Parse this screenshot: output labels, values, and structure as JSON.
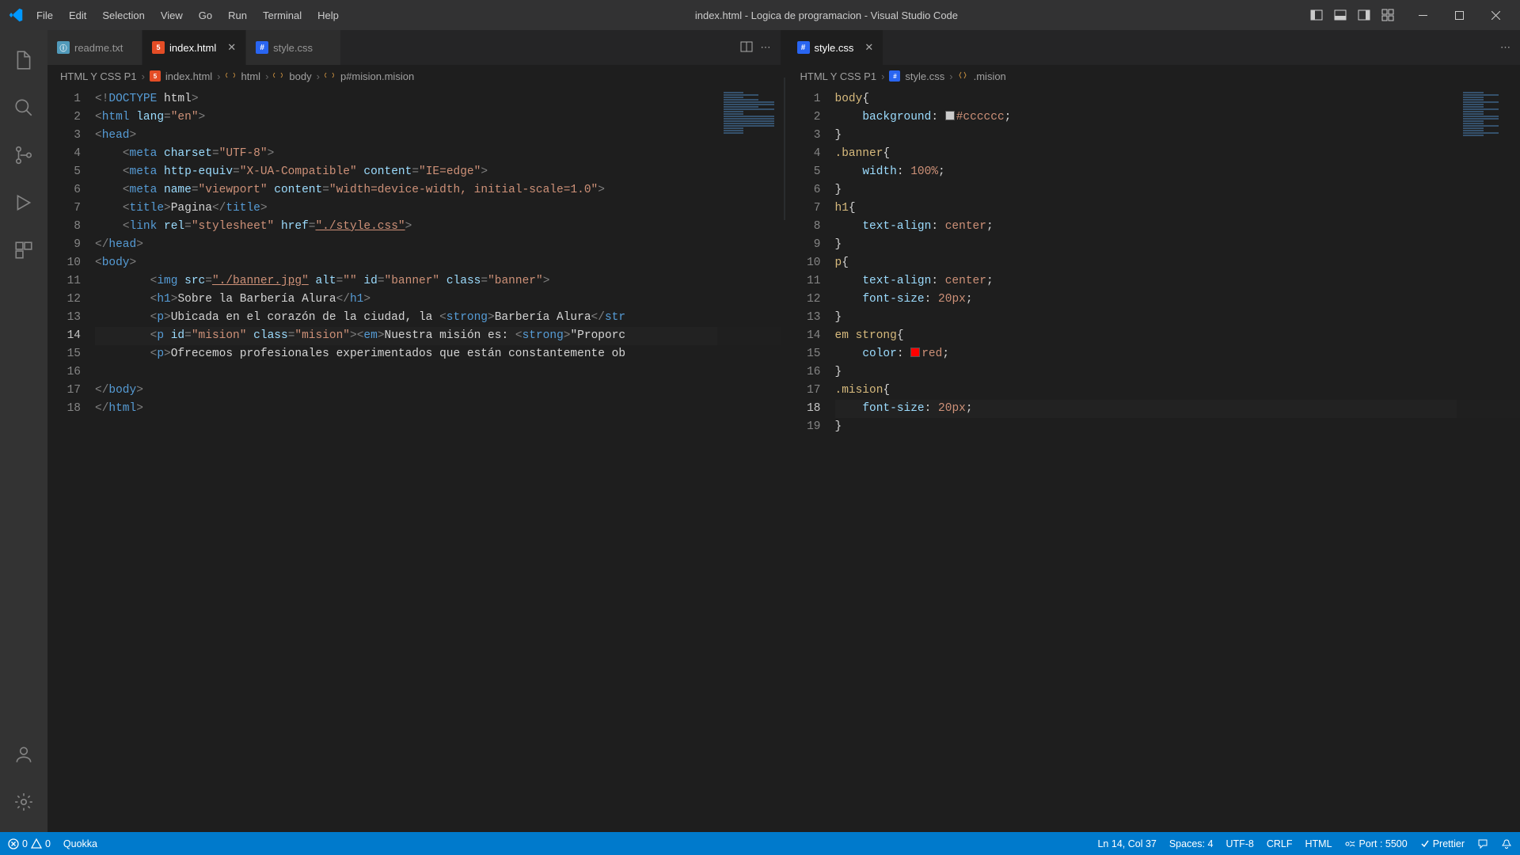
{
  "window": {
    "title": "index.html - Logica de programacion - Visual Studio Code"
  },
  "menu": {
    "items": [
      "File",
      "Edit",
      "Selection",
      "View",
      "Go",
      "Run",
      "Terminal",
      "Help"
    ]
  },
  "left_pane": {
    "tabs": [
      {
        "label": "readme.txt",
        "icon": "txt",
        "active": false,
        "dirty": false
      },
      {
        "label": "index.html",
        "icon": "html",
        "active": true,
        "dirty": false
      },
      {
        "label": "style.css",
        "icon": "css",
        "active": false,
        "dirty": false
      }
    ],
    "breadcrumb": [
      "HTML Y CSS P1",
      "index.html",
      "html",
      "body",
      "p#mision.mision"
    ],
    "line_count": 18,
    "active_line": 14
  },
  "right_pane": {
    "tabs": [
      {
        "label": "style.css",
        "icon": "css",
        "active": true,
        "dirty": false
      }
    ],
    "breadcrumb": [
      "HTML Y CSS P1",
      "style.css",
      ".mision"
    ],
    "line_count": 19,
    "active_line": 18
  },
  "css_code": {
    "rules": [
      {
        "selector": "body",
        "props": [
          {
            "name": "background",
            "value": "#cccccc",
            "chip": "#cccccc"
          }
        ]
      },
      {
        "selector": ".banner",
        "props": [
          {
            "name": "width",
            "value": "100%"
          }
        ]
      },
      {
        "selector": "h1",
        "props": [
          {
            "name": "text-align",
            "value": "center"
          }
        ]
      },
      {
        "selector": "p",
        "props": [
          {
            "name": "text-align",
            "value": "center"
          },
          {
            "name": "font-size",
            "value": "20px"
          }
        ]
      },
      {
        "selector": "em strong",
        "props": [
          {
            "name": "color",
            "value": "red",
            "chip": "#ff0000"
          }
        ]
      },
      {
        "selector": ".mision",
        "props": [
          {
            "name": "font-size",
            "value": "20px"
          }
        ]
      }
    ]
  },
  "html_code": {
    "doctype": "html",
    "lang": "en",
    "head": {
      "meta": [
        {
          "charset": "UTF-8"
        },
        {
          "http-equiv": "X-UA-Compatible",
          "content": "IE=edge"
        },
        {
          "name": "viewport",
          "content": "width=device-width, initial-scale=1.0"
        }
      ],
      "title": "Pagina",
      "stylesheet": "./style.css"
    },
    "body": {
      "img": {
        "src": "./banner.jpg",
        "alt": "",
        "id": "banner",
        "class": "banner"
      },
      "h1": "Sobre la Barbería Alura",
      "p1_prefix": "Ubicada en el corazón de la ciudad, la ",
      "p1_strong": "Barbería Alura",
      "p2_id": "mision",
      "p2_class": "mision",
      "p2_em": "Nuestra misión es: ",
      "p2_strong": "\"Proporc",
      "p3": "Ofrecemos profesionales experimentados que están constantemente ob"
    }
  },
  "status": {
    "errors": "0",
    "warnings": "0",
    "quokka": "Quokka",
    "cursor": "Ln 14, Col 37",
    "spaces": "Spaces: 4",
    "encoding": "UTF-8",
    "eol": "CRLF",
    "language": "HTML",
    "port": "Port : 5500",
    "formatter": "Prettier"
  }
}
